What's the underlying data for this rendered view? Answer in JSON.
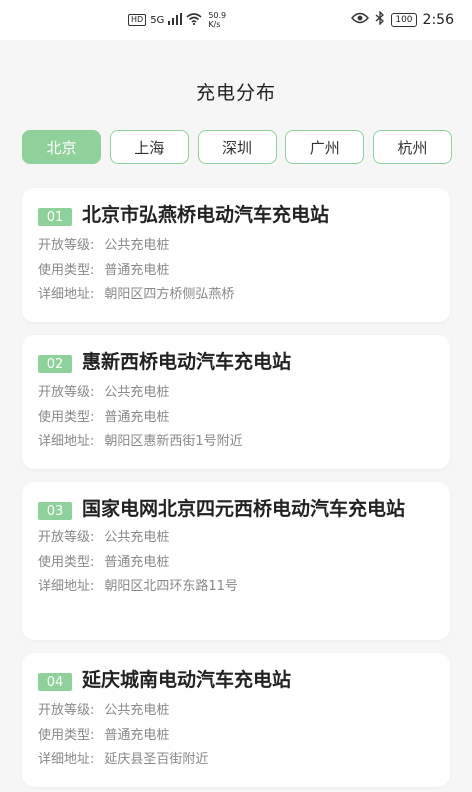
{
  "status_bar": {
    "hd": "HD",
    "network": "5G",
    "speed_value": "50.9",
    "speed_unit": "K/s",
    "battery": "100",
    "time": "2:56"
  },
  "page_title": "充电分布",
  "tabs": [
    {
      "label": "北京",
      "active": true
    },
    {
      "label": "上海",
      "active": false
    },
    {
      "label": "深圳",
      "active": false
    },
    {
      "label": "广州",
      "active": false
    },
    {
      "label": "杭州",
      "active": false
    }
  ],
  "field_labels": {
    "level": "开放等级:",
    "type": "使用类型:",
    "address": "详细地址:"
  },
  "stations": [
    {
      "num": "01",
      "name": "北京市弘燕桥电动汽车充电站",
      "level": "公共充电桩",
      "type": "普通充电桩",
      "address": "朝阳区四方桥侧弘燕桥"
    },
    {
      "num": "02",
      "name": "惠新西桥电动汽车充电站",
      "level": "公共充电桩",
      "type": "普通充电桩",
      "address": "朝阳区惠新西街1号附近"
    },
    {
      "num": "03",
      "name": "国家电网北京四元西桥电动汽车充电站",
      "level": "公共充电桩",
      "type": "普通充电桩",
      "address": "朝阳区北四环东路11号"
    },
    {
      "num": "04",
      "name": "延庆城南电动汽车充电站",
      "level": "公共充电桩",
      "type": "普通充电桩",
      "address": "延庆县圣百街附近"
    }
  ]
}
